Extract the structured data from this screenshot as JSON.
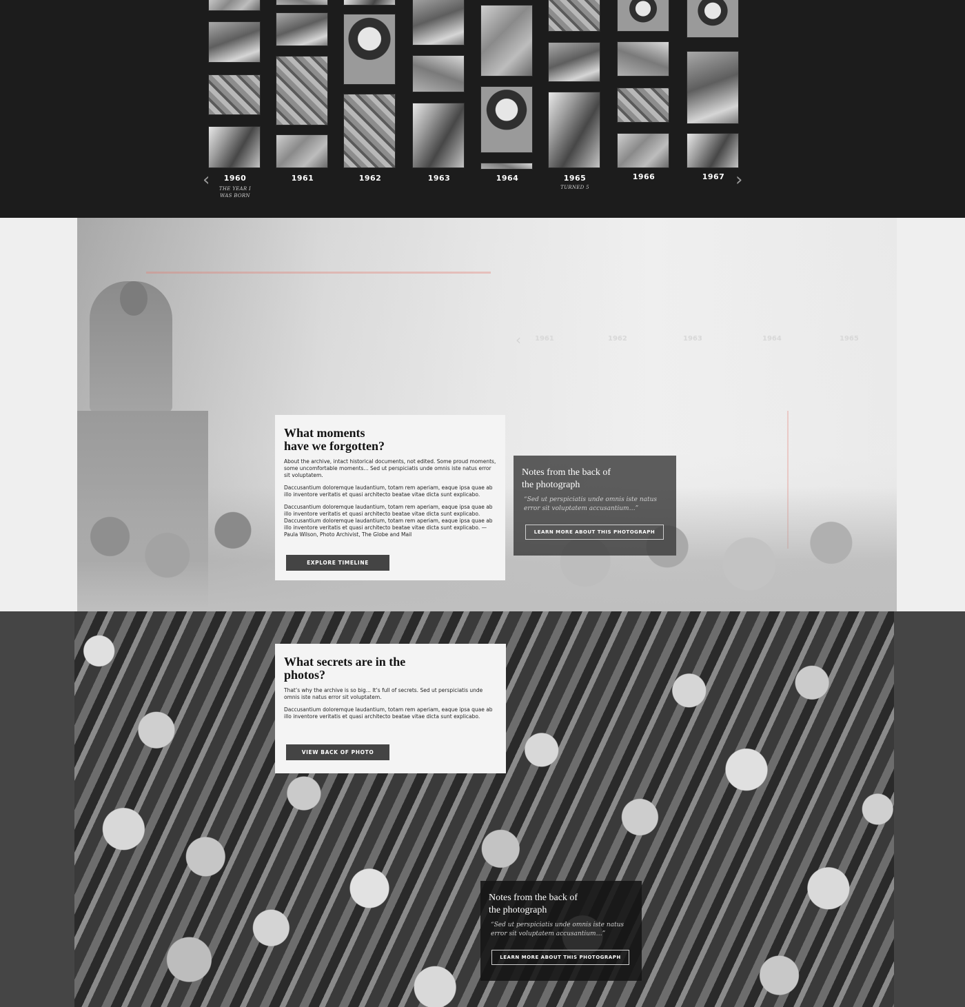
{
  "timeline": {
    "years": [
      {
        "label": "1960",
        "note": "THE YEAR I WAS BORN"
      },
      {
        "label": "1961",
        "note": ""
      },
      {
        "label": "1962",
        "note": ""
      },
      {
        "label": "1963",
        "note": ""
      },
      {
        "label": "1964",
        "note": ""
      },
      {
        "label": "1965",
        "note": "TURNED 5"
      },
      {
        "label": "1966",
        "note": ""
      },
      {
        "label": "1967",
        "note": ""
      }
    ],
    "prev_icon": "chevron-left-icon",
    "next_icon": "chevron-right-icon"
  },
  "ghost_timeline": [
    "1961",
    "1962",
    "1963",
    "1964",
    "1965"
  ],
  "moments_card": {
    "title_line1": "What moments",
    "title_line2": "have we forgotten?",
    "p1": "About the archive, intact historical documents, not edited. Some proud moments, some uncomfortable moments... Sed ut perspiciatis unde omnis iste natus error sit voluptatem.",
    "p2": "Daccusantium doloremque laudantium, totam rem aperiam, eaque ipsa quae ab illo inventore veritatis et quasi architecto beatae vitae dicta sunt explicabo.",
    "p3": "Daccusantium doloremque laudantium, totam rem aperiam, eaque ipsa quae ab illo inventore veritatis et quasi architecto beatae vitae dicta sunt explicabo. Daccusantium doloremque laudantium, totam rem aperiam, eaque ipsa quae ab illo inventore veritatis et quasi architecto beatae vitae dicta sunt explicabo. — Paula Wilson, Photo Archivist, The Globe and Mail",
    "button": "EXPLORE TIMELINE"
  },
  "note_card_1": {
    "title_line1": "Notes from the back of",
    "title_line2": "the photograph",
    "quote": "“Sed ut perspiciatis unde omnis iste natus error sit voluptatem accusantium…”",
    "button": "LEARN MORE ABOUT THIS PHOTOGRAPH"
  },
  "secrets_card": {
    "title_line1": "What secrets are in the",
    "title_line2": "photos?",
    "p1": "That’s why the archive is so big... It’s full of secrets. Sed ut perspiciatis unde omnis iste natus error sit voluptatem.",
    "p2": "Daccusantium doloremque laudantium, totam rem aperiam, eaque ipsa quae ab illo inventore veritatis et quasi architecto beatae vitae dicta sunt explicabo.",
    "button": "VIEW BACK OF PHOTO"
  },
  "note_card_2": {
    "title_line1": "Notes from the back of",
    "title_line2": "the photograph",
    "quote": "“Sed ut perspiciatis unde omnis iste natus error sit voluptatem accusantium…”",
    "button": "LEARN MORE ABOUT THIS PHOTOGRAPH"
  },
  "colors": {
    "timeline_bg": "#1c1c1c",
    "section2_bg": "#efefef",
    "section3_bg": "#454545",
    "button_dark": "#444444"
  }
}
